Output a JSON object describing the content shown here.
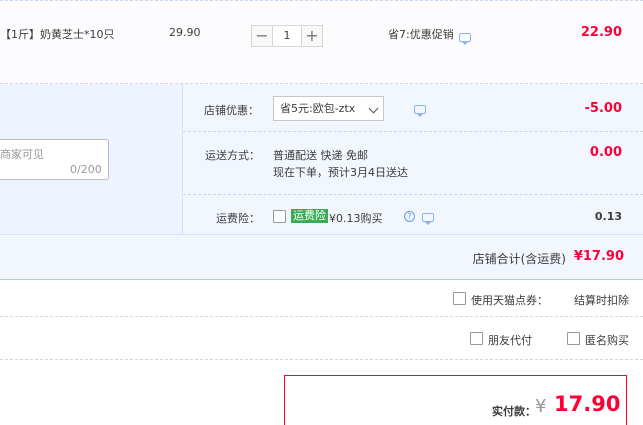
{
  "item": {
    "spec": "【1斤】奶黄芝士*10只",
    "price": "29.90",
    "qty_minus": "−",
    "qty": "1",
    "qty_plus": "+",
    "promo": "省7:优惠促销",
    "subtotal": "22.90"
  },
  "shop": {
    "message_placeholder": "商家可见",
    "message_count": "0/200",
    "discount_label": "店铺优惠：",
    "discount_select": "省5元:欧包-ztx",
    "discount_amount": "-5.00",
    "shipping_label": "运送方式：",
    "shipping_method": "普通配送 快递 免邮",
    "shipping_eta": "现在下单，预计3月4日送达",
    "shipping_amount": "0.00",
    "insurance_label": "运费险：",
    "insurance_tag": "运费险",
    "insurance_text": "¥0.13购买",
    "insurance_amount": "0.13",
    "total_label": "店铺合计(含运费)",
    "total_value": "¥17.90"
  },
  "options": {
    "tmall_points": "使用天猫点券：",
    "settle_deduct": "结算时扣除",
    "friend_pay": "朋友代付",
    "anonymous": "匿名购买"
  },
  "payment": {
    "label": "实付款：",
    "currency": "¥",
    "value": "17.90"
  },
  "colors": {
    "accent_red": "#ff0036",
    "panel_blue": "#f2f7ff",
    "insurance_green": "#39ab53"
  }
}
